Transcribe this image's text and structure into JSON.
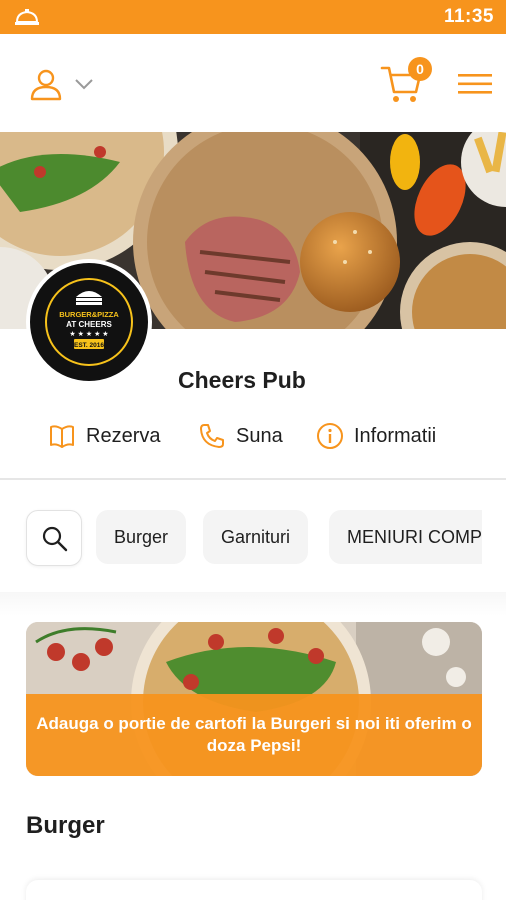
{
  "status_bar": {
    "time": "11:35",
    "icon": "bell-icon"
  },
  "app_bar": {
    "user_icon": "user-icon",
    "dropdown_icon": "chevron-down-icon",
    "cart_icon": "cart-icon",
    "cart_count": "0",
    "menu_icon": "hamburger-menu-icon"
  },
  "restaurant": {
    "name": "Cheers Pub",
    "logo_text": [
      "BURGER&PIZZA",
      "AT CHEERS",
      "EST. 2016"
    ]
  },
  "actions": [
    {
      "label": "Rezerva",
      "icon": "book-icon"
    },
    {
      "label": "Suna",
      "icon": "phone-icon"
    },
    {
      "label": "Informatii",
      "icon": "info-icon"
    }
  ],
  "categories": {
    "search_icon": "search-icon",
    "items": [
      "Burger",
      "Garnituri",
      "MENIURI COMPLETE"
    ]
  },
  "promo": {
    "text": "Adauga o portie de cartofi la Burgeri si noi iti oferim o doza Pepsi!"
  },
  "section": {
    "title": "Burger"
  },
  "colors": {
    "accent": "#f7941d",
    "text": "#1f1f1f",
    "chip_bg": "#f4f4f4"
  }
}
